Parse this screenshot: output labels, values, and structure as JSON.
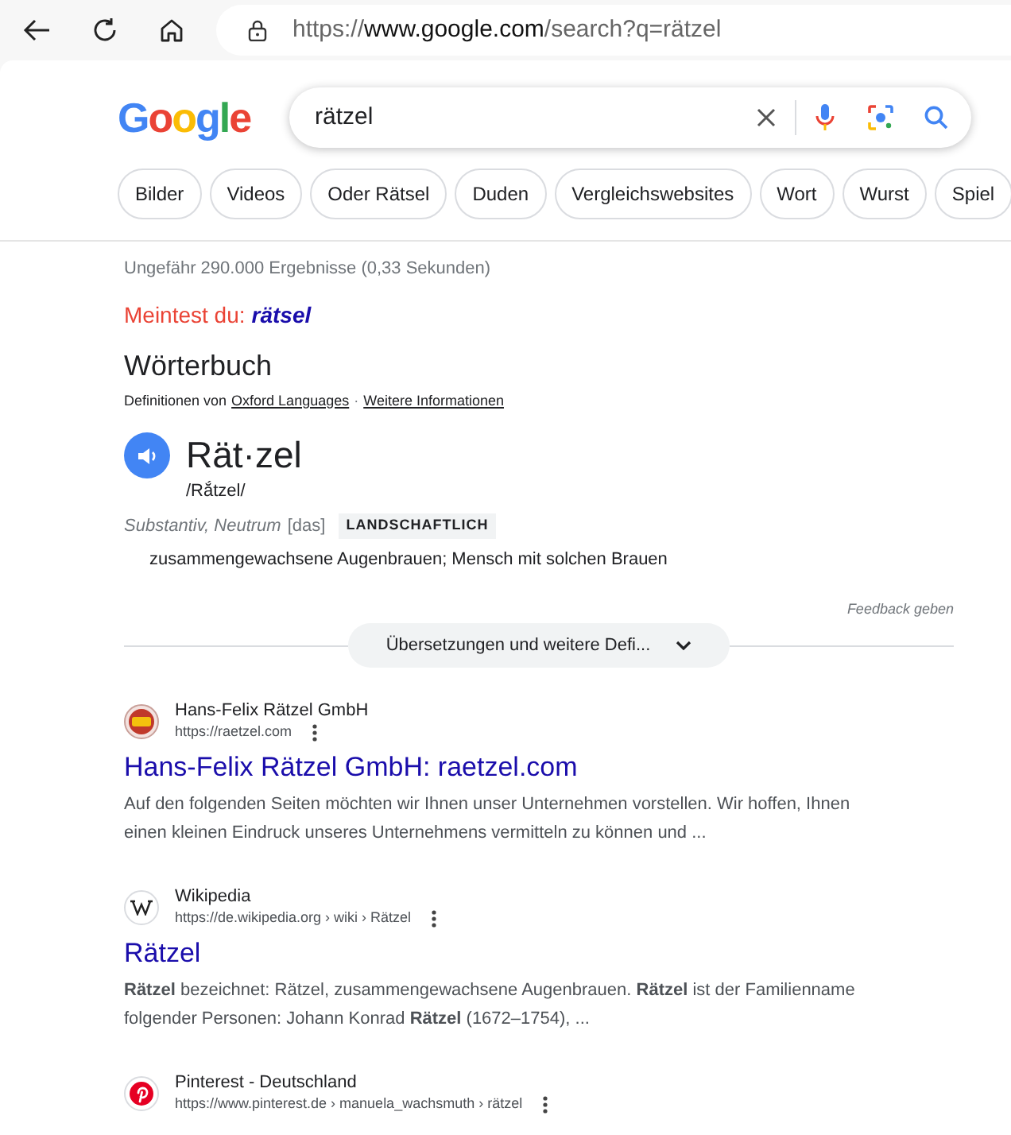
{
  "browser": {
    "url": {
      "scheme": "https://",
      "host": "www.google.com",
      "path": "/search?q=rätzel"
    }
  },
  "logo": "Google",
  "search": {
    "value": "rätzel"
  },
  "chips": [
    "Bilder",
    "Videos",
    "Oder Rätsel",
    "Duden",
    "Vergleichswebsites",
    "Wort",
    "Wurst",
    "Spiel"
  ],
  "result_stats": "Ungefähr 290.000 Ergebnisse (0,33 Sekunden)",
  "did_you_mean": {
    "label": "Meintest du:",
    "suggestion": "rätsel"
  },
  "dictionary": {
    "heading": "Wörterbuch",
    "source_prefix": "Definitionen von",
    "source_link": "Oxford Languages",
    "separator": "·",
    "more_link": "Weitere Informationen",
    "word": "Rät·zel",
    "pronunciation": "/Rắtzel/",
    "grammar": "Substantiv, Neutrum",
    "article": "[das]",
    "register": "LANDSCHAFTLICH",
    "definition": "zusammengewachsene Augenbrauen; Mensch mit solchen Brauen",
    "feedback": "Feedback geben",
    "expand": "Übersetzungen und weitere Defi..."
  },
  "results": [
    {
      "kind": "raetzel",
      "site": "Hans-Felix Rätzel GmbH",
      "url": "https://raetzel.com",
      "title": "Hans-Felix Rätzel GmbH: raetzel.com",
      "snippet": "Auf den folgenden Seiten möchten wir Ihnen unser Unternehmen vorstellen. Wir hoffen, Ihnen einen kleinen Eindruck unseres Unternehmens vermitteln zu können und ..."
    },
    {
      "kind": "wikipedia",
      "site": "Wikipedia",
      "url": "https://de.wikipedia.org › wiki › Rätzel",
      "title": "Rätzel",
      "snippet": "**Rätzel** bezeichnet: Rätzel, zusammengewachsene Augenbrauen. **Rätzel** ist der Familienname folgender Personen: Johann Konrad **Rätzel** (1672–1754), ..."
    },
    {
      "kind": "pinterest",
      "site": "Pinterest - Deutschland",
      "url": "https://www.pinterest.de › manuela_wachsmuth › rätzel"
    }
  ]
}
